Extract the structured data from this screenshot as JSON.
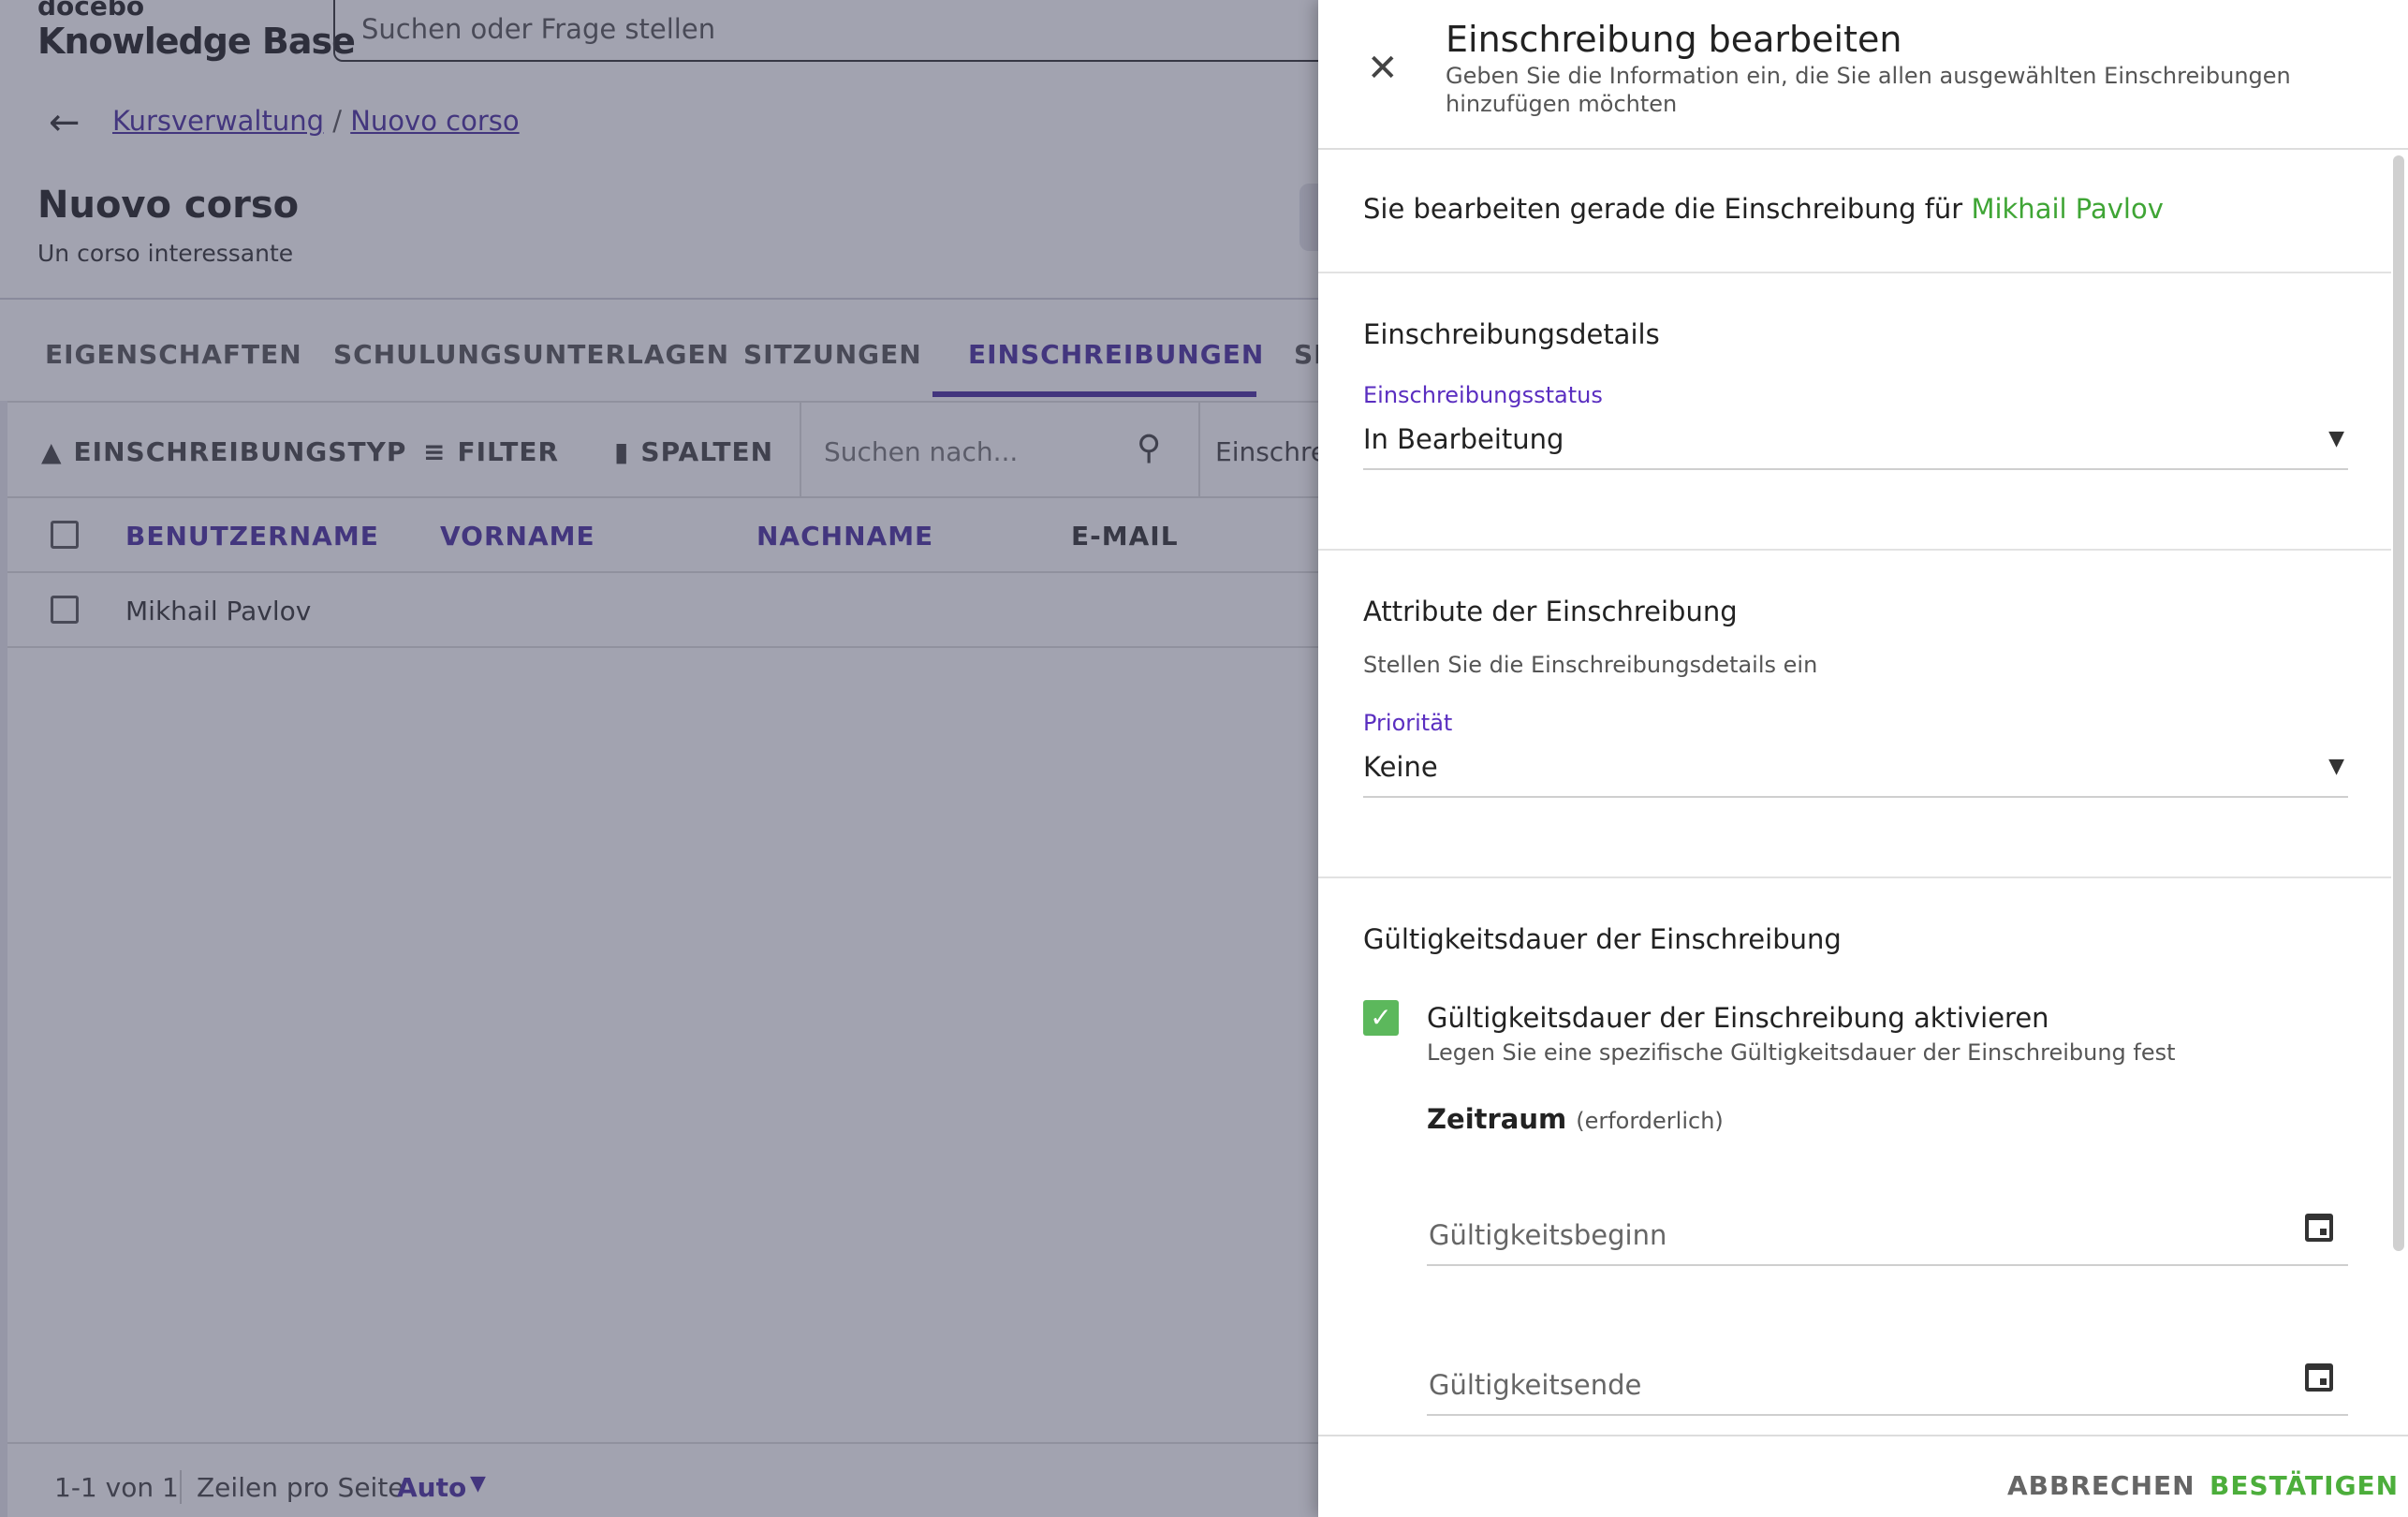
{
  "header": {
    "logo_small": "docebo",
    "logo_big": "Knowledge Base",
    "search_placeholder": "Suchen oder Frage stellen"
  },
  "breadcrumb": {
    "items": [
      "Kursverwaltung",
      "Nuovo corso"
    ],
    "separator": "/"
  },
  "course": {
    "title": "Nuovo corso",
    "subtitle": "Un corso interessante"
  },
  "tabs": [
    "EIGENSCHAFTEN",
    "SCHULUNGSUNTERLAGEN",
    "SITZUNGEN",
    "EINSCHREIBUNGEN",
    "SI"
  ],
  "active_tab": "EINSCHREIBUNGEN",
  "toolbar": {
    "enrollment_type": "EINSCHREIBUNGSTYP",
    "filter": "FILTER",
    "columns": "SPALTEN",
    "search_placeholder": "Suchen nach...",
    "truncated_filter": "Einschrei"
  },
  "table": {
    "headers": [
      "BENUTZERNAME",
      "VORNAME",
      "NACHNAME",
      "E-MAIL"
    ],
    "rows": [
      [
        "Mikhail Pavlov",
        "",
        "",
        ""
      ]
    ]
  },
  "pagination": {
    "range": "1-1 von 1",
    "rows_per_page_label": "Zeilen pro Seite",
    "rows_per_page_value": "Auto"
  },
  "drawer": {
    "title": "Einschreibung bearbeiten",
    "subtitle": "Geben Sie die Information ein, die Sie allen ausgewählten Einschreibungen hinzufügen möchten",
    "intro_prefix": "Sie bearbeiten gerade die Einschreibung für",
    "intro_user": "Mikhail Pavlov",
    "details_title": "Einschreibungsdetails",
    "status_label": "Einschreibungsstatus",
    "status_value": "In Bearbeitung",
    "attributes_title": "Attribute der Einschreibung",
    "attributes_hint": "Stellen Sie die Einschreibungsdetails ein",
    "priority_label": "Priorität",
    "priority_value": "Keine",
    "validity_title": "Gültigkeitsdauer der Einschreibung",
    "validity_checkbox_label": "Gültigkeitsdauer der Einschreibung aktivieren",
    "validity_checkbox_hint": "Legen Sie eine spezifische Gültigkeitsdauer der Einschreibung fest",
    "validity_checked": true,
    "period_label": "Zeitraum",
    "period_required": "(erforderlich)",
    "start_placeholder": "Gültigkeitsbeginn",
    "end_placeholder": "Gültigkeitsende",
    "cancel_label": "ABBRECHEN",
    "confirm_label": "BESTÄTIGEN"
  },
  "colors": {
    "accent": "#4a2fa0",
    "success": "#4cae3b",
    "overlay": "rgba(60,62,90,0.48)"
  }
}
